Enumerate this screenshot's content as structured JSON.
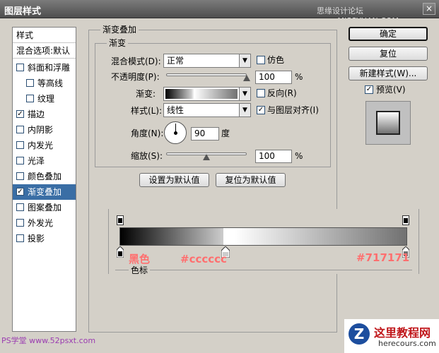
{
  "window": {
    "title": "图层样式",
    "watermark": "思缘设计论坛 www.MISSYUAN.COM",
    "close_label": "×"
  },
  "left_panel": {
    "header": "样式",
    "blend_options": "混合选项:默认",
    "items": [
      {
        "label": "斜面和浮雕",
        "checked": false
      },
      {
        "label": "等高线",
        "checked": false
      },
      {
        "label": "纹理",
        "checked": false
      },
      {
        "label": "描边",
        "checked": true
      },
      {
        "label": "内阴影",
        "checked": false
      },
      {
        "label": "内发光",
        "checked": false
      },
      {
        "label": "光泽",
        "checked": false
      },
      {
        "label": "颜色叠加",
        "checked": false
      },
      {
        "label": "渐变叠加",
        "checked": true
      },
      {
        "label": "图案叠加",
        "checked": false
      },
      {
        "label": "外发光",
        "checked": false
      },
      {
        "label": "投影",
        "checked": false
      }
    ]
  },
  "gradient_overlay": {
    "title": "渐变叠加",
    "sub_title": "渐变",
    "blend_mode_label": "混合模式(D):",
    "blend_mode_value": "正常",
    "dither_label": "仿色",
    "opacity_label": "不透明度(P):",
    "opacity_value": "100",
    "opacity_unit": "%",
    "opacity_level": 1.0,
    "gradient_label": "渐变:",
    "reverse_label": "反向(R)",
    "style_label": "样式(L):",
    "style_value": "线性",
    "align_label": "与图层对齐(I)",
    "align_checked": true,
    "angle_label": "角度(N):",
    "angle_value": "90",
    "angle_unit": "度",
    "scale_label": "缩放(S):",
    "scale_value": "100",
    "scale_unit": "%",
    "scale_level": 0.5,
    "set_default": "设置为默认值",
    "reset_default": "复位为默认值"
  },
  "right_buttons": {
    "ok": "确定",
    "reset": "复位",
    "new_style": "新建样式(W)...",
    "preview_label": "预览(V)",
    "preview_checked": true
  },
  "gradient_editor": {
    "stop_label_left": "黑色",
    "stop_label_mid": "#cccccc",
    "stop_label_right": "#717171",
    "color_stops_title": "色标",
    "colors": {
      "left": "#000000",
      "mid": "#cccccc",
      "right": "#717171"
    }
  },
  "footer": {
    "logo_text": "PS学堂 www.52psxt.com",
    "brand_name": "这里教程网",
    "brand_url": "herecours.com"
  }
}
